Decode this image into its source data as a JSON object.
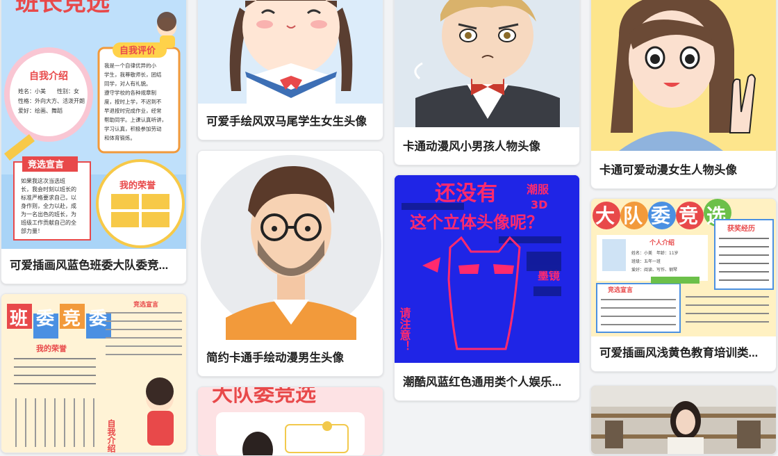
{
  "cards": [
    {
      "title": "可爱插画风蓝色班委大队委竞...",
      "poster_heading": "班长竞选",
      "about_title": "自我介绍",
      "about_lines": [
        "姓名：小美　　性别：女",
        "性格：外向大方、活泼开朗",
        "爱好：绘画、舞蹈"
      ],
      "eval_title": "自我评价",
      "eval_lines": [
        "我是一个自律优异的小",
        "学生，我尊敬师长，团结",
        "同学，对人有礼貌。",
        "遵守学校的各种规章制",
        "度，按时上学，不迟到不",
        "早退按时完成作业，经常",
        "帮助同学。上课认真听讲，",
        "学习认真，积极参加劳动",
        "和体育锻炼。"
      ],
      "decl_title": "竞选宣言",
      "decl_lines": [
        "如果我这次当选班",
        "长，我会时刻以班长的",
        "标准严格要求自己，以",
        "身作则，全力以赴，成",
        "为一名出色的班长，为",
        "班级工作贡献自己的全",
        "部力量！"
      ],
      "honor_title": "我的荣誉"
    },
    {
      "title": "可爱手绘风双马尾学生女生头像"
    },
    {
      "title": "简约卡通手绘动漫男生头像"
    },
    {
      "title": "卡通动漫风小男孩人物头像"
    },
    {
      "title": "潮酷风蓝红色通用类个人娱乐...",
      "poster_lines": [
        "还没有",
        "潮服",
        "3D",
        "这个立体头像呢？",
        "墨镜",
        "请注意！"
      ]
    },
    {
      "title": "卡通可爱动漫女生人物头像"
    },
    {
      "title": "可爱插画风浅黄色教育培训类...",
      "poster_heading": "大队委竞选",
      "exp_title": "获奖经历",
      "intro_title": "个人介绍",
      "intro_lines": [
        "姓名：小美　年龄：11岁",
        "班级：五年一班",
        "爱好：阅读、写作、钢琴"
      ],
      "decl_title": "竞选宣言"
    },
    {
      "poster_heading": "班委竞委",
      "honor_title": "我的荣誉",
      "decl_title": "竞选宣言",
      "intro_title": "自我介绍"
    },
    {
      "poster_heading": "大队委竞选"
    },
    {}
  ]
}
